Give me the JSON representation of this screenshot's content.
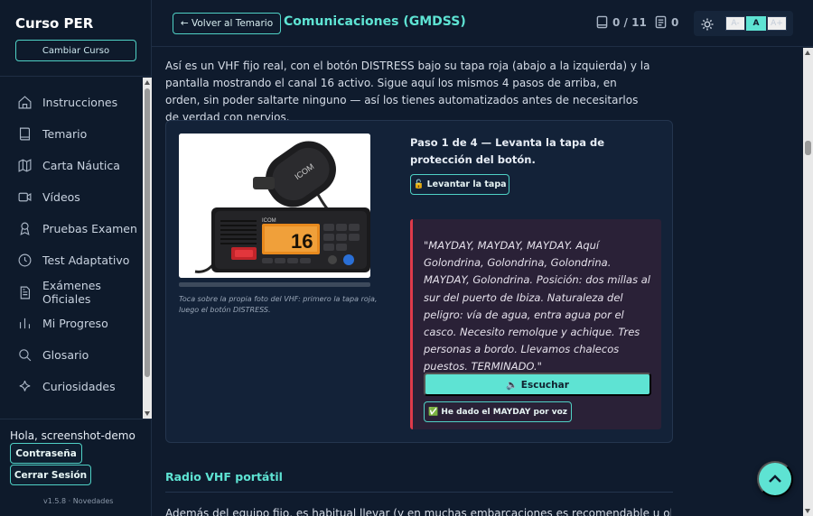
{
  "sidebar": {
    "brand": "Curso PER",
    "change_course": "Cambiar Curso",
    "items": [
      {
        "label": "Instrucciones",
        "icon": "home-icon"
      },
      {
        "label": "Temario",
        "icon": "book-icon"
      },
      {
        "label": "Carta Náutica",
        "icon": "map-icon"
      },
      {
        "label": "Vídeos",
        "icon": "video-icon"
      },
      {
        "label": "Pruebas Examen",
        "icon": "award-icon"
      },
      {
        "label": "Test Adaptativo",
        "icon": "clock-icon"
      },
      {
        "label": "Exámenes Oficiales",
        "icon": "document-icon"
      },
      {
        "label": "Mi Progreso",
        "icon": "bar-chart-icon"
      },
      {
        "label": "Glosario",
        "icon": "search-icon"
      },
      {
        "label": "Curiosidades",
        "icon": "sparkle-icon"
      }
    ],
    "greeting": "Hola, screenshot-demo",
    "password_button": "Contraseña",
    "logout_button": "Cerrar Sesión",
    "version": "v1.5.8 · Novedades"
  },
  "header": {
    "back_button": "← Volver al Temario",
    "title": "Comunicaciones (GMDSS)",
    "progress_count": "0 / 11",
    "notes_count": "0",
    "font_small": "A-",
    "font_normal": "A",
    "font_large": "A+"
  },
  "main": {
    "intro": "Así es un VHF fijo real, con el botón DISTRESS bajo su tapa roja (abajo a la izquierda) y la pantalla mostrando el canal 16 activo. Sigue aquí los mismos 4 pasos de arriba, en orden, sin poder saltarte ninguno — así los tienes automatizados antes de necesitarlos de verdad con nervios.",
    "photo_caption": "Toca sobre la propia foto del VHF: primero la tapa roja, luego el botón DISTRESS.",
    "radio_brand": "ICOM",
    "radio_channel": "16",
    "step_title": "Paso 1 de 4 — Levanta la tapa de protección del botón.",
    "lift_button": "🔓 Levantar la tapa",
    "mayday_text": "\"MAYDAY, MAYDAY, MAYDAY. Aquí Golondrina, Golondrina, Golondrina. MAYDAY, Golondrina. Posición: dos millas al sur del puerto de Ibiza. Naturaleza del peligro: vía de agua, entra agua por el casco. Necesito remolque y achique. Tres personas a bordo. Llevamos chalecos puestos. TERMINADO.\"",
    "listen_button": "🔈 Escuchar",
    "done_button": "✅ He dado el MAYDAY por voz",
    "next_section_title": "Radio VHF portátil",
    "next_section_text": "Además del equipo fijo, es habitual llevar (y en muchas embarcaciones es recomendable u obligatorio"
  },
  "colors": {
    "accent": "#5ee3d3",
    "background": "#0f1b2d",
    "mayday_border": "#e03a4a"
  }
}
